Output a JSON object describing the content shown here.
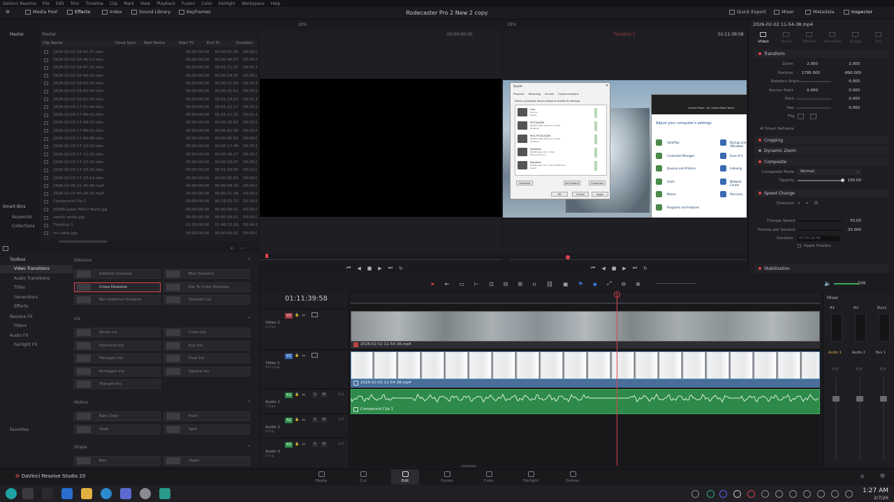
{
  "menubar": {
    "items": [
      "DaVinci Resolve",
      "File",
      "Edit",
      "Trim",
      "Timeline",
      "Clip",
      "Mark",
      "View",
      "Playback",
      "Fusion",
      "Color",
      "Fairlight",
      "Workspace",
      "Help"
    ]
  },
  "toolbar": {
    "left": [
      "Media Pool",
      "Effects",
      "Index",
      "Sound Library",
      "Keyframes"
    ],
    "project_title": "Rodecaster Pro 2 New 2 copy",
    "right": [
      "Quick Export",
      "Mixer",
      "Metadata",
      "Inspector"
    ]
  },
  "media_pool": {
    "bin_label": "Master",
    "master_label": "Master",
    "zoom": "18%",
    "columns": [
      "Clip Name",
      "Cloud Sync",
      "Reel Name",
      "Start TC",
      "End TC",
      "Duration"
    ],
    "rows": [
      {
        "name": "2026-02-03 16-42-37.mkv",
        "start": "00:00:00:00",
        "end": "00:00:07:26",
        "dur": "00:00:07"
      },
      {
        "name": "2026-02-03 16-46-13.mkv",
        "start": "00:00:00:00",
        "end": "00:00:46:57",
        "dur": "00:00:46"
      },
      {
        "name": "2026-02-03 16-47-10.mkv",
        "start": "00:00:00:00",
        "end": "00:01:11:21",
        "dur": "00:01:11"
      },
      {
        "name": "2026-02-03 16-49-22.mkv",
        "start": "00:00:00:00",
        "end": "00:00:29:35",
        "dur": "00:00:29"
      },
      {
        "name": "2026-02-03 16-50-26.mkv",
        "start": "00:00:00:00",
        "end": "00:00:12:59",
        "dur": "00:00:12"
      },
      {
        "name": "2026-02-03 16-50-54.mkv",
        "start": "00:00:00:00",
        "end": "00:00:25:52",
        "dur": "00:00:25"
      },
      {
        "name": "2026-02-03 16-51-29.mkv",
        "start": "00:00:00:00",
        "end": "00:01:14:03",
        "dur": "00:01:14"
      },
      {
        "name": "2026-02-03 17-01-44.mkv",
        "start": "00:00:00:00",
        "end": "00:01:22:17",
        "dur": "00:01:22"
      },
      {
        "name": "2026-02-03 17-06-41.mkv",
        "start": "00:00:00:00",
        "end": "00:01:11:21",
        "dur": "00:01:11"
      },
      {
        "name": "2026-02-03 17-08-15.mkv",
        "start": "00:00:00:00",
        "end": "00:00:26:43",
        "dur": "00:00:26"
      },
      {
        "name": "2026-02-03 17-08-51.mkv",
        "start": "00:00:00:00",
        "end": "00:00:42:08",
        "dur": "00:00:42"
      },
      {
        "name": "2026-02-03 17-09-48.mkv",
        "start": "00:00:00:00",
        "end": "00:00:56:59",
        "dur": "00:00:56"
      },
      {
        "name": "2026-02-03 17-10-52.mkv",
        "start": "00:00:00:00",
        "end": "00:00:17:49",
        "dur": "00:00:17"
      },
      {
        "name": "2026-02-03 17-12-33.mkv",
        "start": "00:00:00:00",
        "end": "00:00:36:27",
        "dur": "00:00:36"
      },
      {
        "name": "2026-02-03 17-13-18.mkv",
        "start": "00:00:00:00",
        "end": "00:00:29:37",
        "dur": "00:00:29"
      },
      {
        "name": "2026-02-03 17-16-26.mkv",
        "start": "00:00:00:00",
        "end": "00:01:00:00",
        "dur": "00:01:00"
      },
      {
        "name": "2026-02-03 17-20-14.mkv",
        "start": "00:00:00:00",
        "end": "00:00:05:43",
        "dur": "00:00:05"
      },
      {
        "name": "2026-02-06 21-36-58.mp4",
        "start": "00:00:00:00",
        "end": "00:00:04:28",
        "dur": "00:00:04"
      },
      {
        "name": "2026-02-07 00-24-25.mp4",
        "start": "00:00:00:00",
        "end": "00:00:21:28",
        "dur": "00:00:21"
      },
      {
        "name": "Compound Clip 1",
        "start": "00:00:00:00",
        "end": "00:18:52:33",
        "dur": "00:18:52"
      },
      {
        "name": "RODECaster PRO II Back.jpg",
        "start": "00:00:00:00",
        "end": "00:00:00:01",
        "dur": "00:00:00"
      },
      {
        "name": "switch audio.jpg",
        "start": "00:00:00:00",
        "end": "00:00:00:01",
        "dur": "00:00:00"
      },
      {
        "name": "Timeline 1",
        "start": "01:00:00:00",
        "end": "01:46:12:29",
        "dur": "00:46:12"
      },
      {
        "name": "rm cable.jpg",
        "start": "00:00:00:00",
        "end": "00:00:00:01",
        "dur": "00:00:00"
      }
    ]
  },
  "smart_bins": {
    "title": "Smart Bins",
    "items": [
      "Keywords",
      "Collections"
    ]
  },
  "effects": {
    "toolbox": "Toolbox",
    "tree": [
      "Video Transitions",
      "Audio Transitions",
      "Titles",
      "Generators",
      "Effects",
      "Resolve FX",
      "Filters",
      "Audio FX",
      "Fairlight FX"
    ],
    "favorites": "Favorites",
    "sections": [
      {
        "title": "Dissolve",
        "items": [
          "Additive Dissolve",
          "Blur Dissolve",
          "Cross Dissolve",
          "Dip To Color Dissolve",
          "Non-Additive Dissolve",
          "Smooth Cut"
        ]
      },
      {
        "title": "Iris",
        "items": [
          "Arrow Iris",
          "Cross Iris",
          "Diamond Iris",
          "Eye Iris",
          "Hexagon Iris",
          "Oval Iris",
          "Pentagon Iris",
          "Square Iris",
          "Triangle Iris"
        ]
      },
      {
        "title": "Motion",
        "items": [
          "Barn Door",
          "Push",
          "Slide",
          "Split"
        ]
      },
      {
        "title": "Shape",
        "items": [
          "Box",
          "Heart"
        ]
      }
    ]
  },
  "source_viewer": {
    "timecode": "00:00:00:00",
    "zoom": "18%"
  },
  "timeline_viewer": {
    "timecode": "01:11:39:58",
    "clip": "Timeline 1"
  },
  "sound_dialog": {
    "title": "Sound",
    "tabs": [
      "Playback",
      "Recording",
      "Sounds",
      "Communications"
    ],
    "instruction": "Select a playback device below to modify its settings:",
    "devices": [
      {
        "name": "Line",
        "sub": "Wie Go",
        "state": "Ready"
      },
      {
        "name": "PG27AQDM",
        "sub": "NVIDIA High Definition Audio",
        "state": "Disabled"
      },
      {
        "name": "ROG PG32UCDM",
        "sub": "NVIDIA High Definition Audio",
        "state": "Disabled"
      },
      {
        "name": "Speakers",
        "sub": "RODECaster Pro II Chat",
        "state": "Default Device"
      },
      {
        "name": "Speakers",
        "sub": "RODECaster Pro II Main Multitrack",
        "state": "Ready"
      }
    ],
    "buttons": [
      "Configure",
      "Set Default",
      "Properties",
      "OK",
      "Cancel",
      "Apply"
    ]
  },
  "control_panel": {
    "path": "Control Panel › All Control Panel Items",
    "heading": "Adjust your computer's settings",
    "items": [
      "AutoPlay",
      "Credential Manager",
      "Devices and Printers",
      "Fonts",
      "Mouse",
      "Programs and Features"
    ],
    "items_right": [
      "Backup and (Windows",
      "Ease of A",
      "Indexing",
      "Network Center",
      "Recovery"
    ]
  },
  "inspector": {
    "title": "2026-02-02 11-54-38.mp4",
    "tabs": [
      "Video",
      "Audio",
      "Effects",
      "Transition",
      "Image",
      "File"
    ],
    "transform": "Transform",
    "zoom_label": "Zoom",
    "zoom_x": "2.000",
    "zoom_y": "2.000",
    "position_label": "Position",
    "pos_x": "1795.000",
    "pos_y": "-890.000",
    "rotation_label": "Rotation Angle",
    "rotation": "0.000",
    "anchor_label": "Anchor Point",
    "anchor_x": "0.000",
    "anchor_y": "0.000",
    "pitch_label": "Pitch",
    "pitch": "0.000",
    "yaw_label": "Yaw",
    "yaw": "0.000",
    "flip_label": "Flip",
    "smart_reframe": "AI Smart Reframe",
    "cropping": "Cropping",
    "dynamic_zoom": "Dynamic Zoom",
    "composite": "Composite",
    "composite_mode_label": "Composite Mode",
    "composite_mode": "Normal",
    "opacity_label": "Opacity",
    "opacity": "100.00",
    "speed_change": "Speed Change",
    "direction_label": "Direction",
    "change_speed_label": "Change Speed",
    "change_speed": "55.00",
    "fps_label": "Frames per Second",
    "fps": "33.000",
    "duration_label": "Duration",
    "duration": "00:05:24:48",
    "ripple": "Ripple Timeline",
    "stabilization": "Stabilization"
  },
  "timeline": {
    "timecode": "01:11:39:58",
    "tracks": [
      {
        "id": "V2",
        "name": "Video 2",
        "clips": "2 Clips"
      },
      {
        "id": "V1",
        "name": "Video 1",
        "clips": "107 Clips"
      },
      {
        "id": "A1",
        "name": "Audio 1",
        "clips": "7 Clips",
        "level": "2.0"
      },
      {
        "id": "A2",
        "name": "Audio 2",
        "clips": "0 Clip",
        "level": "2.0"
      },
      {
        "id": "A3",
        "name": "Audio 3",
        "clips": "0 Clip",
        "level": "2.0"
      }
    ],
    "clip_v2": "2026-02-02 11-54-38.mp4",
    "clip_v1": "2026-02-02 11-54-38.mp4",
    "clip_a1": "Compound Clip 1",
    "dim": "DIM"
  },
  "mixer": {
    "title": "Mixer",
    "cols": [
      "A1",
      "A2",
      "Bus1"
    ],
    "channels": [
      "Audio 1",
      "Audio 2",
      "Bus 1"
    ],
    "levels": [
      "0.0",
      "0.0",
      "0.0"
    ]
  },
  "pages": [
    "Media",
    "Cut",
    "Edit",
    "Fusion",
    "Color",
    "Fairlight",
    "Deliver"
  ],
  "app_name": "DaVinci Resolve Studio 20",
  "clock": {
    "time": "1:27 AM",
    "date": "2/7/26"
  },
  "colors": {
    "accent": "#e0434b",
    "active_tab": "#2b2b31",
    "clip_video": "#5a8fc0",
    "clip_audio": "#3ea85a"
  }
}
